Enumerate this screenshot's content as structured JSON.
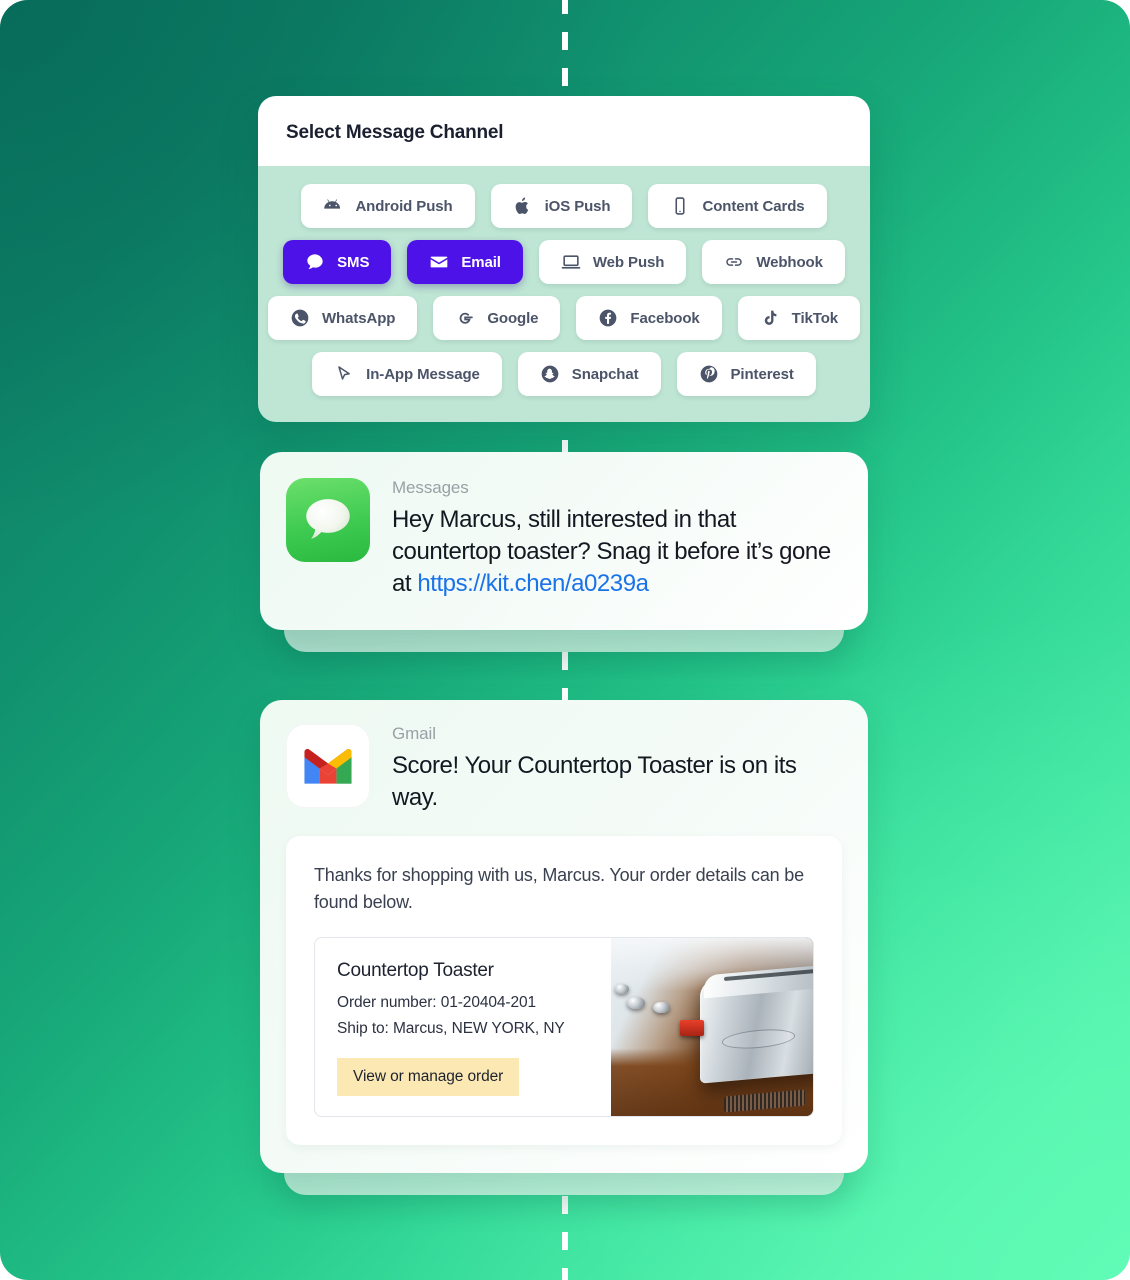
{
  "background": {
    "gradient_from": "#0b7a63",
    "gradient_to": "#5cf7b2"
  },
  "channel_panel": {
    "title": "Select Message Channel",
    "accent_color": "#4d12e8",
    "body_bg": "#bfe6d4",
    "rows": [
      [
        {
          "label": "Android Push",
          "icon": "android-icon",
          "selected": false
        },
        {
          "label": "iOS Push",
          "icon": "apple-icon",
          "selected": false
        },
        {
          "label": "Content Cards",
          "icon": "phone-icon",
          "selected": false
        }
      ],
      [
        {
          "label": "SMS",
          "icon": "chat-bubble-icon",
          "selected": true
        },
        {
          "label": "Email",
          "icon": "envelope-icon",
          "selected": true
        },
        {
          "label": "Web Push",
          "icon": "laptop-icon",
          "selected": false
        },
        {
          "label": "Webhook",
          "icon": "link-icon",
          "selected": false
        }
      ],
      [
        {
          "label": "WhatsApp",
          "icon": "whatsapp-icon",
          "selected": false
        },
        {
          "label": "Google",
          "icon": "google-icon",
          "selected": false
        },
        {
          "label": "Facebook",
          "icon": "facebook-icon",
          "selected": false
        },
        {
          "label": "TikTok",
          "icon": "tiktok-icon",
          "selected": false
        }
      ],
      [
        {
          "label": "In-App Message",
          "icon": "cursor-icon",
          "selected": false
        },
        {
          "label": "Snapchat",
          "icon": "snapchat-icon",
          "selected": false
        },
        {
          "label": "Pinterest",
          "icon": "pinterest-icon",
          "selected": false
        }
      ]
    ]
  },
  "sms_notification": {
    "app_name": "Messages",
    "app_icon": "messages-app-icon",
    "text_before_link": "Hey Marcus, still interested in that countertop toaster? Snag it before it’s gone at ",
    "link_text": "https://kit.chen/a0239a",
    "link_color": "#1a73e8"
  },
  "email_notification": {
    "app_name": "Gmail",
    "app_icon": "gmail-app-icon",
    "subject": "Score! Your Countertop Toaster is on its way.",
    "greeting": "Thanks for shopping with us, Marcus. Your order details can be found below.",
    "order": {
      "product_name": "Countertop Toaster",
      "order_number_line": "Order number: 01-20404-201",
      "ship_to_line": "Ship to: Marcus, NEW YORK, NY",
      "cta_label": "View or manage order",
      "cta_bg": "#fce8b2",
      "photo_alt": "countertop-toaster-photo"
    }
  }
}
